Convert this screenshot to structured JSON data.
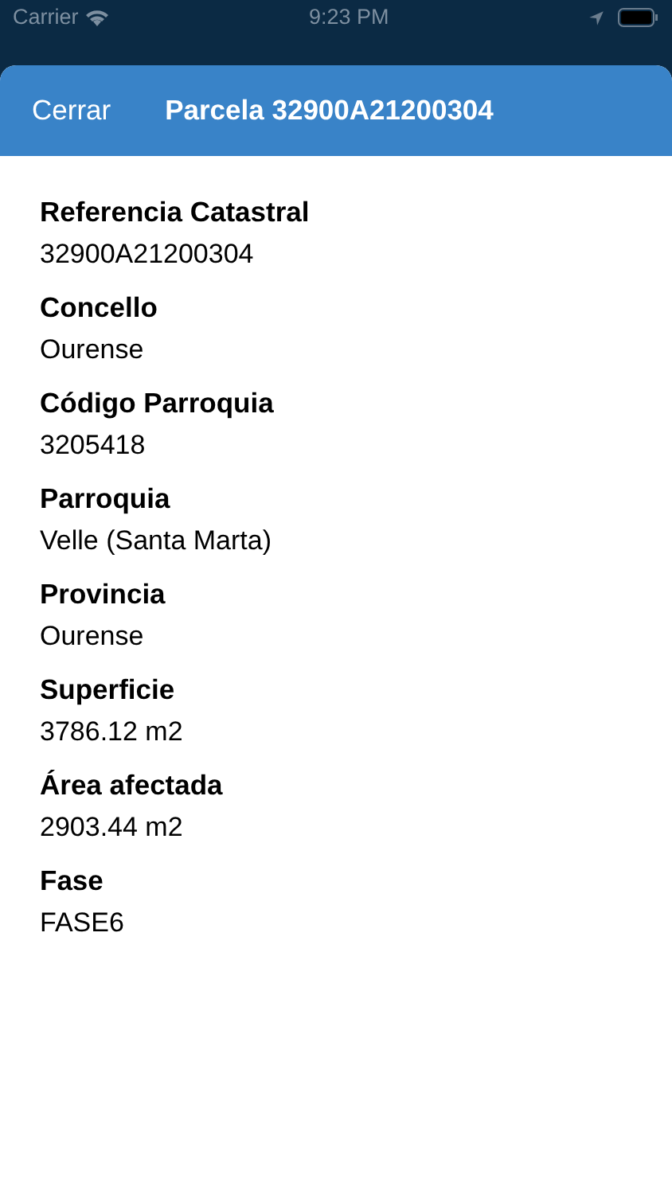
{
  "status_bar": {
    "carrier": "Carrier",
    "time": "9:23 PM"
  },
  "sheet": {
    "close_button": "Cerrar",
    "title": "Parcela 32900A21200304"
  },
  "fields": [
    {
      "label": "Referencia Catastral",
      "value": "32900A21200304"
    },
    {
      "label": "Concello",
      "value": "Ourense"
    },
    {
      "label": "Código Parroquia",
      "value": "3205418"
    },
    {
      "label": "Parroquia",
      "value": "Velle (Santa Marta)"
    },
    {
      "label": "Provincia",
      "value": "Ourense"
    },
    {
      "label": "Superficie",
      "value": "3786.12 m2"
    },
    {
      "label": "Área afectada",
      "value": "2903.44 m2"
    },
    {
      "label": "Fase",
      "value": "FASE6"
    }
  ]
}
